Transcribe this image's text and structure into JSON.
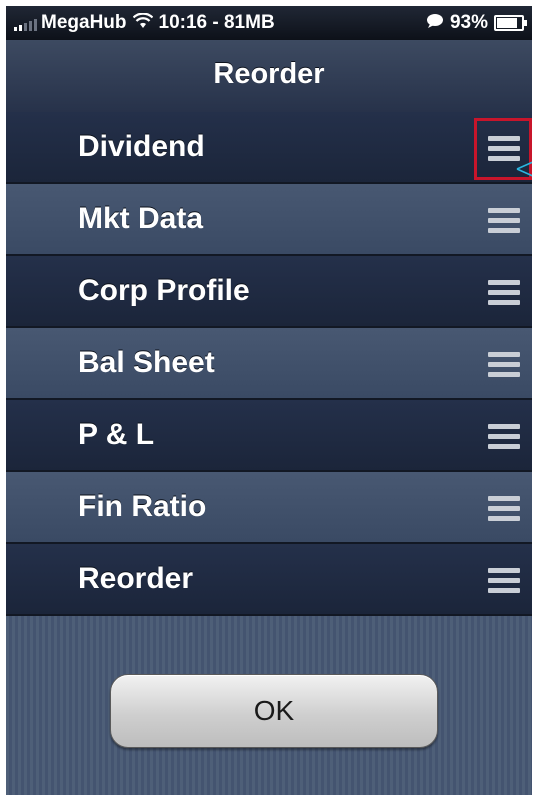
{
  "status_bar": {
    "carrier": "MegaHub",
    "time_memory": "10:16 - 81MB",
    "battery_percent": "93%",
    "battery_level": 0.93,
    "signal_icon": "signal-bars-icon",
    "wifi_icon": "wifi-icon",
    "message_icon": "chat-bubble-icon"
  },
  "nav": {
    "title": "Reorder"
  },
  "rows": [
    {
      "label": "Dividend",
      "handle_icon": "drag-handle-icon"
    },
    {
      "label": "Mkt Data",
      "handle_icon": "drag-handle-icon"
    },
    {
      "label": "Corp Profile",
      "handle_icon": "drag-handle-icon"
    },
    {
      "label": "Bal Sheet",
      "handle_icon": "drag-handle-icon"
    },
    {
      "label": "P & L",
      "handle_icon": "drag-handle-icon"
    },
    {
      "label": "Fin Ratio",
      "handle_icon": "drag-handle-icon"
    },
    {
      "label": "Reorder",
      "handle_icon": "drag-handle-icon"
    }
  ],
  "ok_button": {
    "label": "OK"
  },
  "colors": {
    "highlight_box": "#c8152b",
    "pointer": "#29b6e0"
  }
}
